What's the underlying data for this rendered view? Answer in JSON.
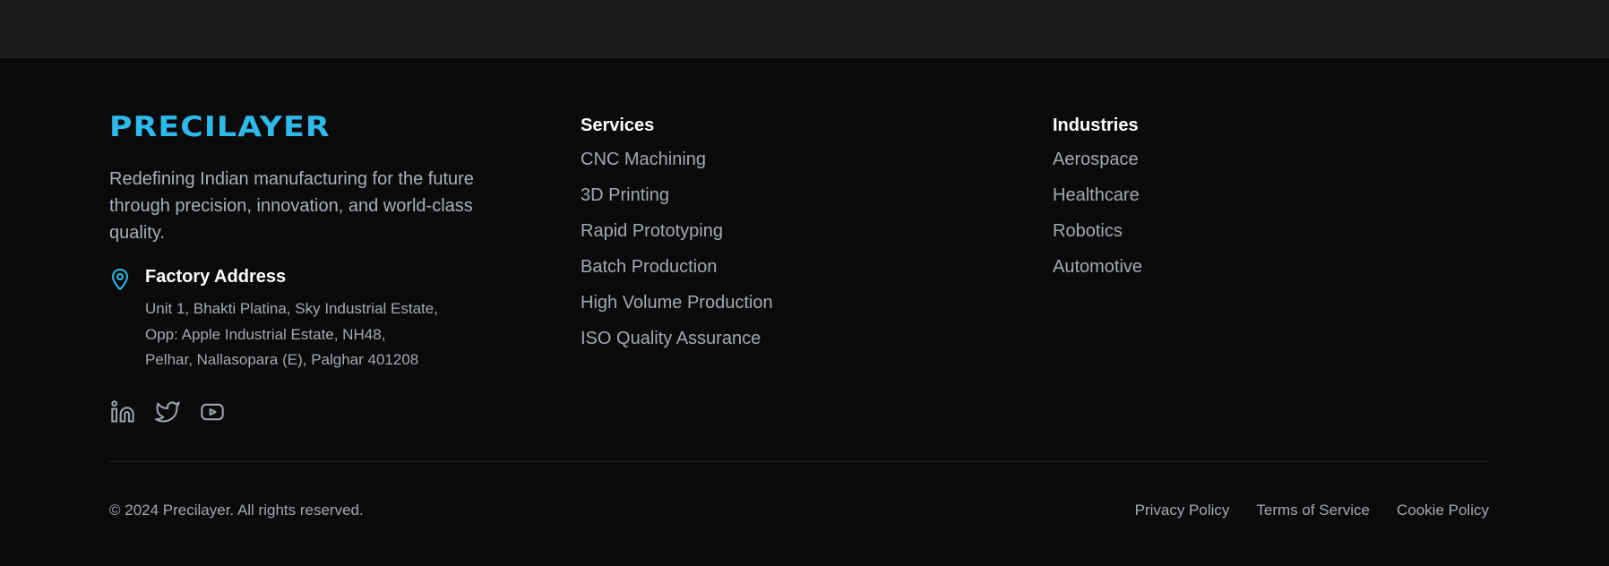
{
  "brand": {
    "logo_text": "PRECILAYER",
    "tagline": "Redefining Indian manufacturing for the future through precision, innovation, and world-class quality.",
    "accent_color": "#2fb9ea"
  },
  "address": {
    "icon": "map-pin-icon",
    "title": "Factory Address",
    "lines": [
      "Unit 1, Bhakti Platina, Sky Industrial Estate,",
      "Opp: Apple Industrial Estate, NH48,",
      "Pelhar, Nallasopara (E), Palghar 401208"
    ]
  },
  "socials": [
    {
      "name": "linkedin",
      "icon": "linkedin-icon"
    },
    {
      "name": "twitter",
      "icon": "twitter-icon"
    },
    {
      "name": "youtube",
      "icon": "youtube-icon"
    }
  ],
  "services": {
    "title": "Services",
    "items": [
      "CNC Machining",
      "3D Printing",
      "Rapid Prototyping",
      "Batch Production",
      "High Volume Production",
      "ISO Quality Assurance"
    ]
  },
  "industries": {
    "title": "Industries",
    "items": [
      "Aerospace",
      "Healthcare",
      "Robotics",
      "Automotive"
    ]
  },
  "bottom": {
    "copyright": "© 2024 Precilayer. All rights reserved.",
    "links": [
      "Privacy Policy",
      "Terms of Service",
      "Cookie Policy"
    ]
  }
}
